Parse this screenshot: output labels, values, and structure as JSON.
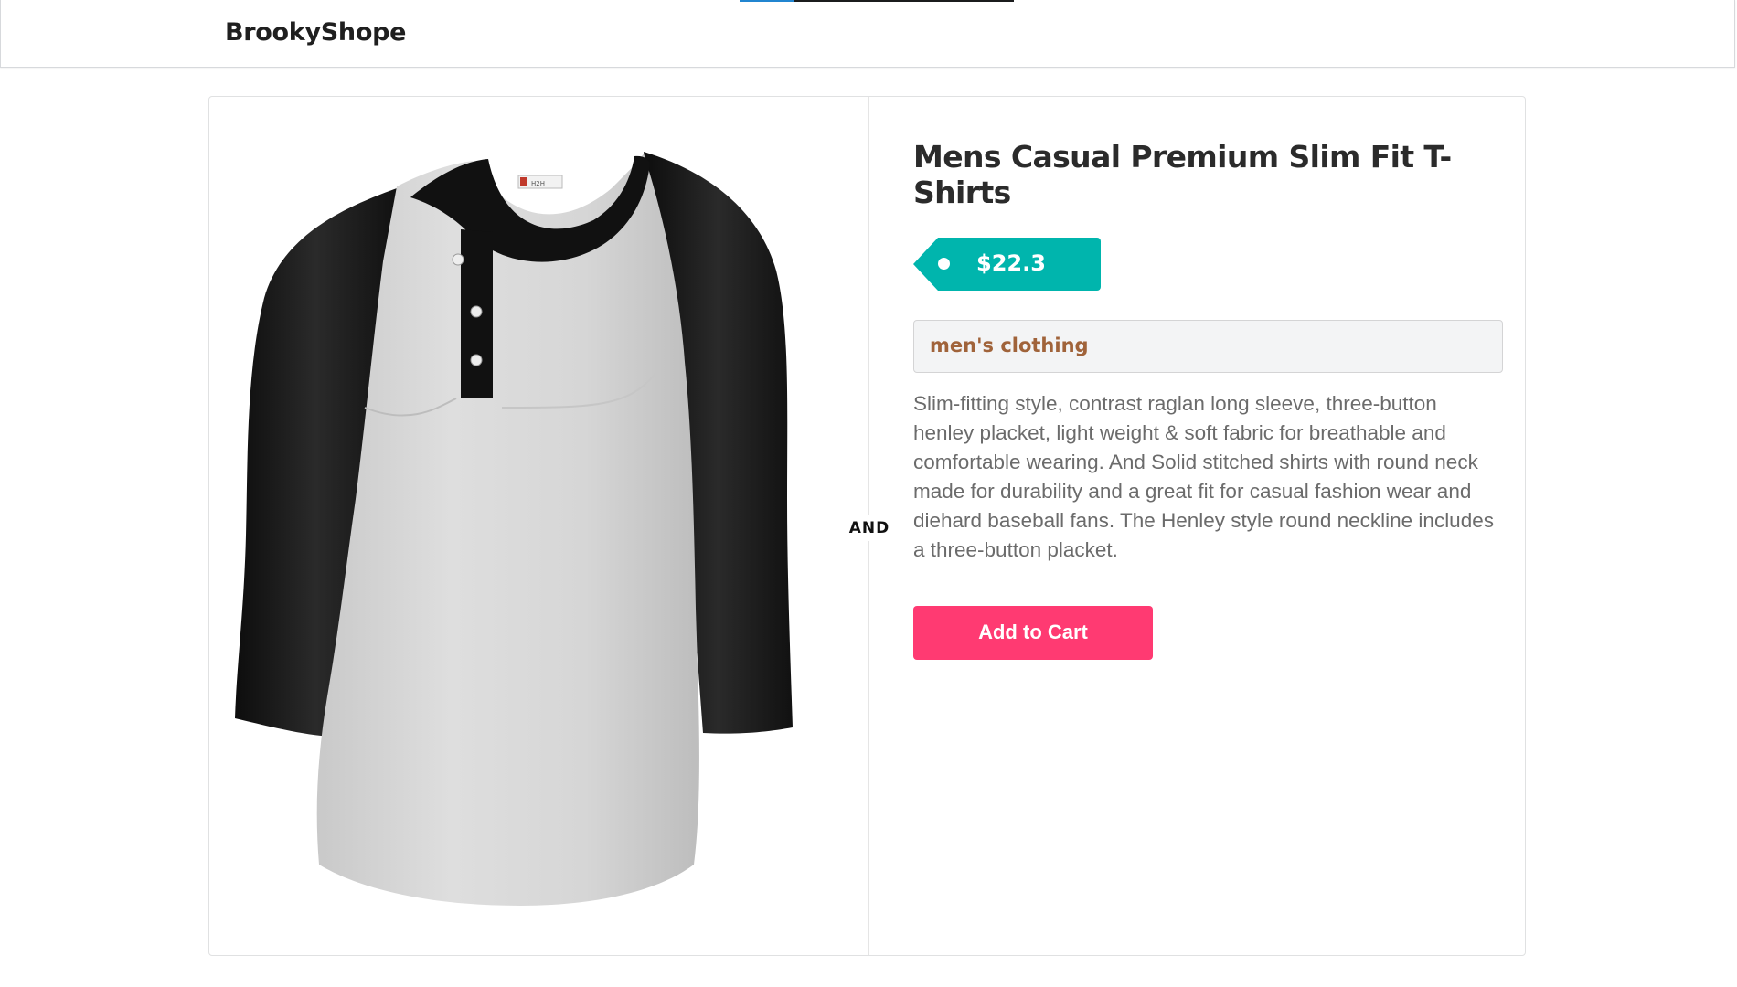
{
  "header": {
    "brand": "BrookyShope"
  },
  "product": {
    "title": "Mens Casual Premium Slim Fit T-Shirts",
    "price": "$22.3",
    "category": "men's clothing",
    "description": "Slim-fitting style, contrast raglan long sleeve, three-button henley placket, light weight & soft fabric for breathable and comfortable wearing. And Solid stitched shirts with round neck made for durability and a great fit for casual fashion wear and diehard baseball fans. The Henley style round neckline includes a three-button placket.",
    "add_to_cart_label": "Add to Cart",
    "divider_label": "AND",
    "image_tag_text": "H2H"
  },
  "colors": {
    "price_tag": "#00b5ad",
    "add_to_cart": "#ff3a72",
    "category_text": "#a0633a",
    "nav_indicator_blue": "#2185d0"
  },
  "icons": {
    "product_image": "raglan-henley-shirt-image"
  }
}
